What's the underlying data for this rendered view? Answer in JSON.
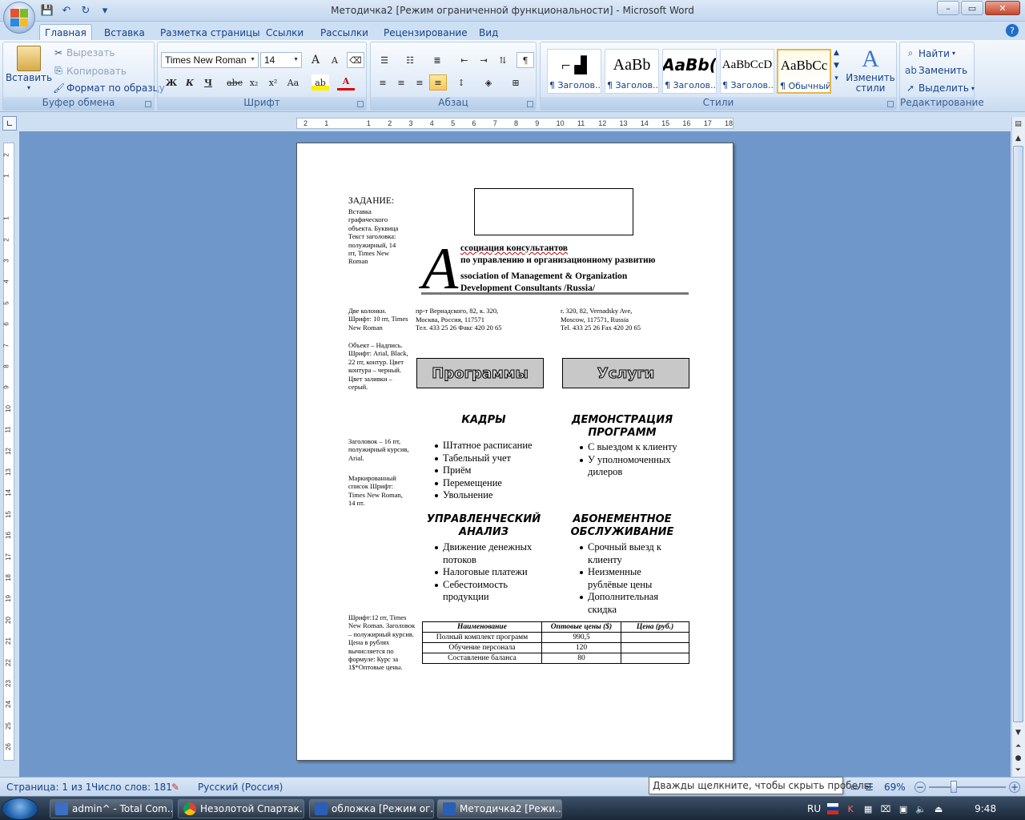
{
  "window": {
    "title": "Методичка2 [Режим ограниченной функциональности] - Microsoft Word",
    "controls": {
      "minimize": "–",
      "maximize": "▭",
      "close": "✕"
    }
  },
  "qat": {
    "save": "💾",
    "undo": "↶",
    "redo": "↻",
    "more": "▾"
  },
  "tabs": [
    "Главная",
    "Вставка",
    "Разметка страницы",
    "Ссылки",
    "Рассылки",
    "Рецензирование",
    "Вид"
  ],
  "active_tab": "Главная",
  "help": "?",
  "ribbon": {
    "clipboard": {
      "label": "Буфер обмена",
      "paste": "Вставить",
      "cut": "Вырезать",
      "copy": "Копировать",
      "format_painter": "Формат по образцу"
    },
    "font": {
      "label": "Шрифт",
      "family": "Times New Roman",
      "size": "14",
      "buttons": [
        "Ж",
        "К",
        "Ч",
        "abc",
        "x₂",
        "x²",
        "Aa"
      ],
      "grow": "A",
      "shrink": "A"
    },
    "paragraph": {
      "label": "Абзац"
    },
    "styles": {
      "label": "Стили",
      "items": [
        {
          "preview": "⌐ ▟",
          "name": "¶ Заголов..."
        },
        {
          "preview": "AaBb",
          "name": "¶ Заголов..."
        },
        {
          "preview": "AaBb(",
          "name": "¶ Заголов..."
        },
        {
          "preview": "AaBbCcD",
          "name": "¶ Заголов..."
        },
        {
          "preview": "AaBbCc",
          "name": "¶ Обычный"
        }
      ],
      "change": "Изменить стили"
    },
    "editing": {
      "label": "Редактирование",
      "find": "Найти",
      "replace": "Заменить",
      "select": "Выделить"
    }
  },
  "document": {
    "notes": {
      "task_title": "ЗАДАНИЕ:",
      "task": "Вставка графического объекта. Буквица Текст заголовка: полужирный, 14 пт, Times New Roman",
      "columns": "Две колонки. Шрифт: 10 пт, Times New Roman",
      "object": "Объект – Надпись. Шрифт: Arial, Black, 22 пт, контур. Цвет контура – черный. Цвет заливки – серый.",
      "heading": "Заголовок – 16 пт, полужирный курсив, Arial.",
      "list": "Маркированный список Шрифт: Times New Roman, 14 пт.",
      "table": "Шрифт:12 пт, Times New Roman. Заголовок – полужирный курсив. Цена в рублях вычисляется по формуле: Курс за 1$*Оптовые цены."
    },
    "dropcap": "А",
    "header_lines": [
      "ссоциация консультантов",
      "по управлению и организационному развитию",
      "ssociation of Management & Organization",
      "Development Consultants /Russia/"
    ],
    "contacts_ru": [
      "пр-т Вернадского, 82, к. 320,",
      "Москва, Россия, 117571",
      "Тел. 433 25 26        Факс 420 20 65"
    ],
    "contacts_en": [
      "r. 320, 82, Vernadsky Ave,",
      "Moscow, 117571, Russia",
      "Tel. 433 25 26        Fax 420 20 65"
    ],
    "buttons": [
      "Программы",
      "Услуги"
    ],
    "sections": [
      {
        "title": "КАДРЫ",
        "items": [
          "Штатное расписание",
          "Табельный учет",
          "Приём",
          "Перемещение",
          "Увольнение"
        ]
      },
      {
        "title": "ДЕМОНСТРАЦИЯ ПРОГРАММ",
        "items": [
          "С выездом к клиенту",
          "У уполномоченных дилеров"
        ]
      },
      {
        "title": "УПРАВЛЕНЧЕСКИЙ АНАЛИЗ",
        "items": [
          "Движение денежных потоков",
          "Налоговые платежи",
          "Себестоимость продукции"
        ]
      },
      {
        "title": "АБОНЕМЕНТНОЕ ОБСЛУЖИВАНИЕ",
        "items": [
          "Срочный выезд к клиенту",
          "Неизменные рублёвые цены",
          "Дополнительная скидка"
        ]
      }
    ],
    "table": {
      "headers": [
        "Наименование",
        "Оптовые цены ($)",
        "Цена (руб.)"
      ],
      "rows": [
        [
          "Полный комплект программ",
          "990,5",
          ""
        ],
        [
          "Обучение персонала",
          "120",
          ""
        ],
        [
          "Составление баланса",
          "80",
          ""
        ]
      ]
    }
  },
  "status": {
    "page": "Страница: 1 из 1",
    "words": "Число слов: 181",
    "language": "Русский (Россия)",
    "zoom": "69%",
    "zoom_minus": "−",
    "zoom_plus": "+"
  },
  "tooltip": "Дважды щелкните, чтобы скрыть пробелы",
  "taskbar": {
    "items": [
      "admin^ - Total Com...",
      "Незолотой Спартак....",
      "обложка [Режим ог...",
      "Методичка2 [Режи..."
    ],
    "lang": "RU",
    "clock": "9:48"
  },
  "colors": {
    "ribbon": "#dce8f6",
    "accent": "#15428b",
    "page": "#ffffff",
    "workspace": "#6f97c9"
  }
}
